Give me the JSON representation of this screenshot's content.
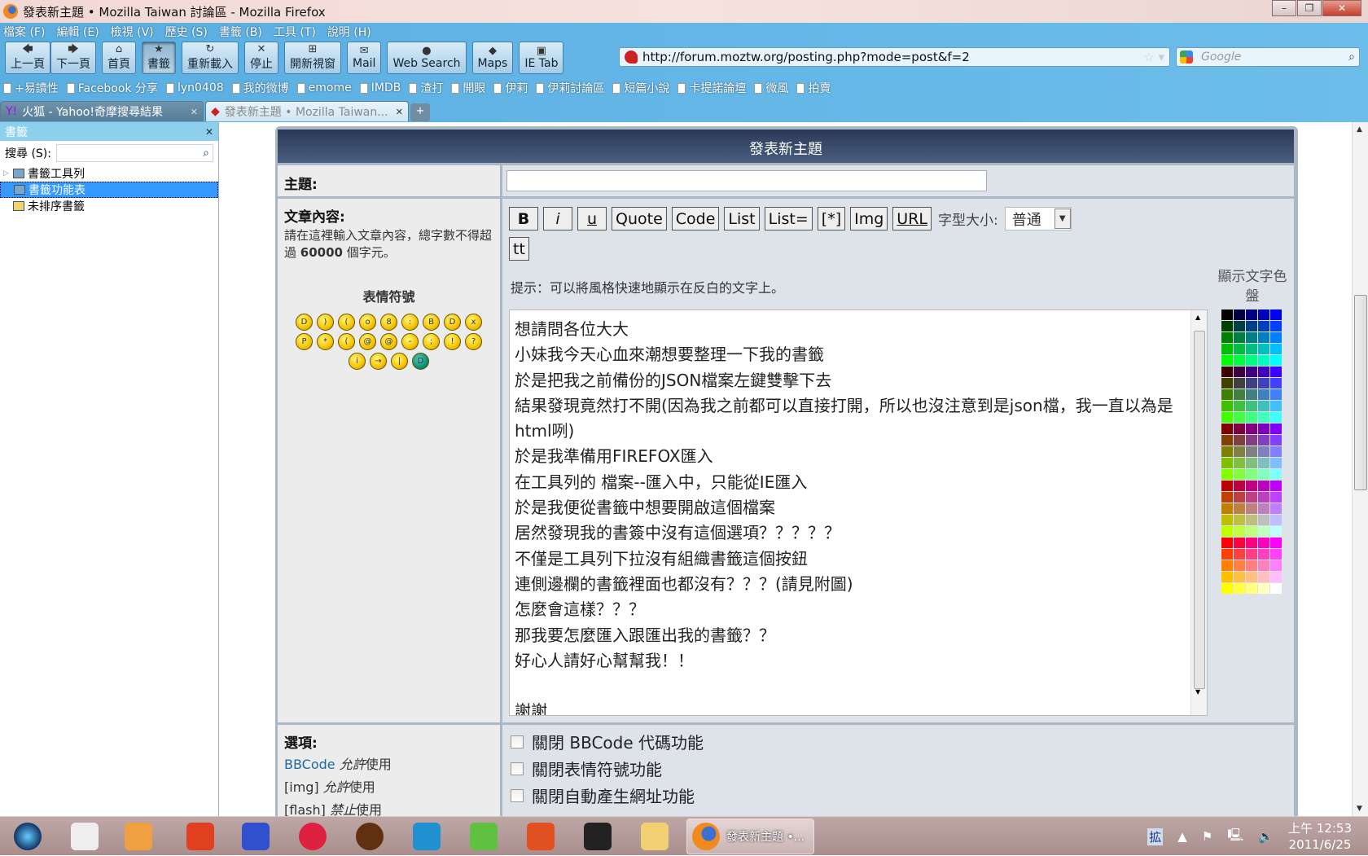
{
  "window": {
    "title": "發表新主題 • Mozilla Taiwan 討論區 - Mozilla Firefox",
    "min": "–",
    "max": "❐",
    "close": "✕"
  },
  "menu": [
    "檔案 (F)",
    "編輯 (E)",
    "檢視 (V)",
    "歷史 (S)",
    "書籤 (B)",
    "工具 (T)",
    "說明 (H)"
  ],
  "toolbar": [
    {
      "icon": "🡄",
      "label": "上一頁"
    },
    {
      "icon": "🡆",
      "label": "下一頁"
    },
    {
      "icon": "⌂",
      "label": "首頁"
    },
    {
      "icon": "★",
      "label": "書籤"
    },
    {
      "icon": "↻",
      "label": "重新載入"
    },
    {
      "icon": "✕",
      "label": "停止"
    },
    {
      "icon": "⊞",
      "label": "開新視窗"
    },
    {
      "icon": "✉",
      "label": "Mail"
    },
    {
      "icon": "●",
      "label": "Web Search"
    },
    {
      "icon": "◆",
      "label": "Maps"
    },
    {
      "icon": "▣",
      "label": "IE Tab"
    }
  ],
  "url": "http://forum.moztw.org/posting.php?mode=post&f=2",
  "search_placeholder": "Google",
  "bookmarks": [
    "+易讀性",
    "Facebook 分享",
    "lyn0408",
    "我的微博",
    "emome",
    "IMDB",
    "渣打",
    "開眼",
    "伊莉",
    "伊莉討論區",
    "短篇小說",
    "卡提諾論壇",
    "微風",
    "拍賣"
  ],
  "tabs": [
    {
      "label": "火狐 - Yahoo!奇摩搜尋結果"
    },
    {
      "label": "發表新主題 • Mozilla Taiwan..."
    }
  ],
  "sidebar": {
    "title": "書籤",
    "search_label": "搜尋 (S):",
    "items": [
      "書籤工具列",
      "書籤功能表",
      "未排序書籤"
    ]
  },
  "form": {
    "header": "發表新主題",
    "subject_label": "主題:",
    "subject_value": "",
    "content_label": "文章內容:",
    "content_hint_1": "請在這裡輸入文章內容，總字數不得超過",
    "content_limit": "60000",
    "content_hint_2": "個字元。",
    "smilies_label": "表情符號",
    "smilies": [
      [
        "D",
        ")",
        "(",
        "o",
        "8",
        ":",
        "B",
        "D",
        "x"
      ],
      [
        "P",
        "*",
        "(",
        "@",
        "@",
        "-",
        ";",
        "!",
        "?"
      ],
      [
        "i",
        "→",
        "|",
        "D"
      ]
    ],
    "bbcode_buttons": [
      "B",
      "i",
      "u",
      "Quote",
      "Code",
      "List",
      "List=",
      "[*]",
      "Img",
      "URL"
    ],
    "tt_button": "tt",
    "font_size_label": "字型大小:",
    "font_size_value": "普通",
    "tip": "提示：可以將風格快速地顯示在反白的文字上。",
    "palette_label": "顯示文字色盤",
    "palette_levels": [
      "00",
      "40",
      "80",
      "BF",
      "FF"
    ],
    "message_lines": [
      "想請問各位大大",
      "小妹我今天心血來潮想要整理一下我的書籤",
      "於是把我之前備份的JSON檔案左鍵雙擊下去",
      "結果發現竟然打不開(因為我之前都可以直接打開，所以也沒注意到是json檔，我一直以為是html咧)",
      "於是我準備用FIREFOX匯入",
      "在工具列的 檔案--匯入中，只能從IE匯入",
      "於是我便從書籤中想要開啟這個檔案",
      "居然發現我的書簽中沒有這個選項？？？？？",
      "不僅是工具列下拉沒有組織書籤這個按鈕",
      "連側邊欄的書籤裡面也都沒有？？？(請見附圖)",
      "怎麼會這樣？？？",
      "那我要怎麼匯入跟匯出我的書籤？？",
      "好心人請好心幫幫我！！",
      "",
      "謝謝"
    ],
    "options_label": "選項:",
    "options_info": [
      {
        "name": "BBCode",
        "state": "允許",
        "suffix": "使用"
      },
      {
        "name": "[img]",
        "state": "允許",
        "suffix": "使用"
      },
      {
        "name": "[flash]",
        "state": "禁止",
        "suffix": "使用"
      }
    ],
    "checkboxes": [
      "關閉 BBCode 代碼功能",
      "關閉表情符號功能",
      "關閉自動產生網址功能"
    ]
  },
  "taskbar": {
    "active_label": "發表新主題 •...",
    "time": "上午 12:53",
    "date": "2011/6/25",
    "ime": "拡"
  },
  "colors": {
    "header": "#3c4d6e",
    "link": "#1b6aa0",
    "selected": "#3399ff"
  }
}
